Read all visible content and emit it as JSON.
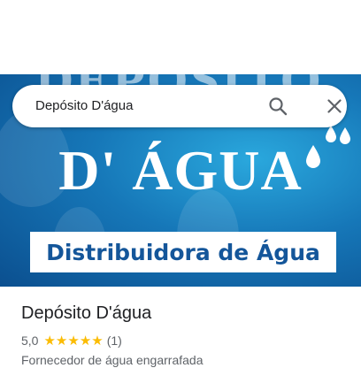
{
  "search": {
    "query": "Depósito D'água"
  },
  "hero": {
    "ghost_text": "DEPÓSITO",
    "title": "D' ÁGUA",
    "banner": "Distribuidora de Água",
    "colors": {
      "background": "#1677b8",
      "banner_text": "#14569a"
    }
  },
  "place": {
    "name": "Depósito D'água",
    "rating": "5,0",
    "stars": 5,
    "reviews": "(1)",
    "category": "Fornecedor de água engarrafada"
  },
  "icons": {
    "search": "search-icon",
    "close": "close-icon",
    "star": "star-icon",
    "drop": "water-drop-icon"
  },
  "colors": {
    "star": "#fbbc04",
    "text": "#202124",
    "secondary": "#5f6368"
  }
}
